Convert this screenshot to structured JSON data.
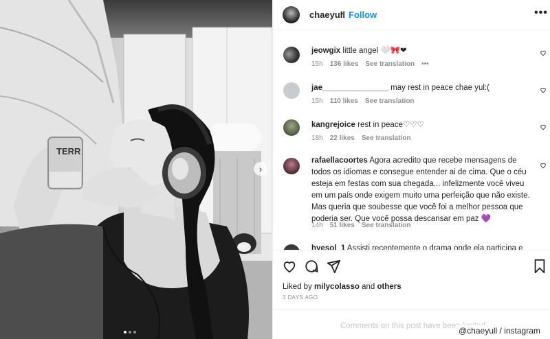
{
  "post": {
    "username": "chaeyull",
    "separator": "•",
    "follow_label": "Follow",
    "more_icon": "more-horizontal-icon"
  },
  "photo": {
    "cup_text": "TERR",
    "next_icon": "chevron-right-icon"
  },
  "comments": [
    {
      "username": "jeowgix",
      "text": "little angel 🤍🎀❤",
      "time": "15h",
      "likes": "136 likes",
      "translate": "See translation",
      "more": "•••"
    },
    {
      "username": "jae_______________",
      "text": "may rest in peace chae yul:(",
      "time": "15h",
      "likes": "110 likes",
      "translate": "See translation"
    },
    {
      "username": "kangrejoice",
      "text": "rest in peace♡♡♡",
      "time": "18h",
      "likes": "22 likes",
      "translate": "See translation"
    },
    {
      "username": "rafaellacoortes",
      "text": "Agora acredito que recebe mensagens de todos os idiomas e consegue entender ai de cima. Que o céu esteja em festas com sua chegada... infelizmente você viveu em um país onde exigem muito uma perfeição que não existe. Mas queria que soubesse que você foi a melhor pessoa que poderia ser. Que você possa descansar em paz 💜",
      "time": "14h",
      "likes": "51 likes",
      "translate": "See translation"
    },
    {
      "username": "hyesol_1",
      "text": "Assisti recentemente o drama onde ela participa e"
    }
  ],
  "likes": {
    "prefix": "Liked by ",
    "user": "milycolasso",
    "middle": " and ",
    "others": "others"
  },
  "date": "3 DAYS AGO",
  "footer": {
    "limited": "Comments on this post have been limited.",
    "credit": "@chaeyull / instagram"
  }
}
